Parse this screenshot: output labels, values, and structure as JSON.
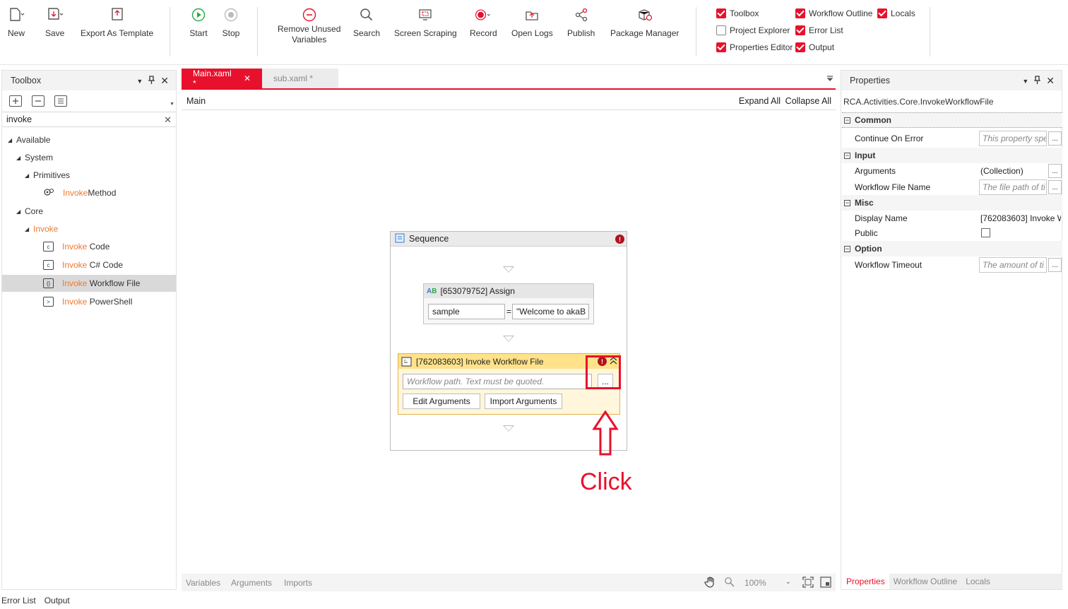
{
  "ribbon": {
    "new": "New",
    "save": "Save",
    "export": "Export As Template",
    "start": "Start",
    "stop": "Stop",
    "remove_unused": "Remove Unused\nVariables",
    "search": "Search",
    "screen_scraping": "Screen Scraping",
    "record": "Record",
    "open_logs": "Open Logs",
    "publish": "Publish",
    "package_manager": "Package Manager",
    "panels": {
      "toolbox": "Toolbox",
      "project_explorer": "Project Explorer",
      "properties_editor": "Properties Editor",
      "workflow_outline": "Workflow Outline",
      "error_list": "Error List",
      "output": "Output",
      "locals": "Locals"
    },
    "accent": "#e8112d"
  },
  "toolbox": {
    "title": "Toolbox",
    "search_value": "invoke",
    "tree": {
      "available": "Available",
      "system": "System",
      "primitives": "Primitives",
      "invoke_method_hl": "Invoke",
      "invoke_method_rest": "Method",
      "core": "Core",
      "invoke_group": "Invoke",
      "invoke_code_hl": "Invoke",
      "invoke_code_rest": " Code",
      "invoke_csharp_hl": "Invoke",
      "invoke_csharp_rest": " C# Code",
      "invoke_wf_hl": "Invoke",
      "invoke_wf_rest": " Workflow File",
      "invoke_ps_hl": "Invoke",
      "invoke_ps_rest": " PowerShell"
    }
  },
  "designer": {
    "tabs": [
      {
        "label": "Main.xaml *",
        "close": "✕"
      },
      {
        "label": "sub.xaml *"
      }
    ],
    "breadcrumb": "Main",
    "expand_all": "Expand All",
    "collapse_all": "Collapse All",
    "sequence": {
      "title": "Sequence",
      "assign": {
        "title": "[653079752] Assign",
        "to": "sample",
        "eq": "=",
        "value": "\"Welcome to akaB"
      },
      "invoke": {
        "title": "[762083603] Invoke Workflow File",
        "path_placeholder": "Workflow path. Text must be quoted.",
        "browse": "...",
        "edit_args": "Edit Arguments",
        "import_args": "Import Arguments"
      }
    },
    "annotation": "Click",
    "footer": {
      "variables": "Variables",
      "arguments": "Arguments",
      "imports": "Imports",
      "zoom": "100%"
    }
  },
  "properties": {
    "title": "Properties",
    "type_name": "RCA.Activities.Core.InvokeWorkflowFile",
    "categories": {
      "common": "Common",
      "input": "Input",
      "misc": "Misc",
      "option": "Option"
    },
    "rows": {
      "continue_on_error": "Continue On Error",
      "continue_on_error_val": "This property spe",
      "arguments": "Arguments",
      "arguments_val": "(Collection)",
      "wf_file_name": "Workflow File Name",
      "wf_file_name_val": "The file path of ti",
      "display_name": "Display Name",
      "display_name_val": "[762083603] Invoke W",
      "public": "Public",
      "workflow_timeout": "Workflow Timeout",
      "workflow_timeout_val": "The amount of ti"
    },
    "ellipsis": "...",
    "bottom_tabs": [
      "Properties",
      "Workflow Outline",
      "Locals"
    ]
  },
  "statusbar": {
    "error_list": "Error List",
    "output": "Output"
  }
}
